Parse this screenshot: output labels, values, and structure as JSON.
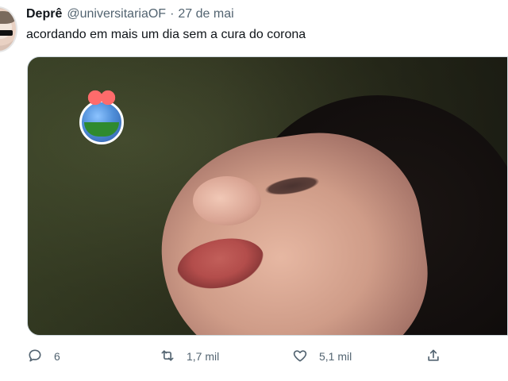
{
  "tweet": {
    "author_name": "Deprê",
    "author_handle": "@universitariaOF",
    "separator": "·",
    "date": "27 de mai",
    "text": "acordando em mais um dia sem a cura do corona"
  },
  "actions": {
    "reply": {
      "icon": "reply-icon",
      "count": "6"
    },
    "retweet": {
      "icon": "retweet-icon",
      "count": "1,7 mil"
    },
    "like": {
      "icon": "heart-icon",
      "count": "5,1 mil"
    },
    "share": {
      "icon": "share-icon",
      "count": ""
    }
  },
  "colors": {
    "text_primary": "#0f1419",
    "text_secondary": "#536471",
    "border": "#cfd9de"
  }
}
